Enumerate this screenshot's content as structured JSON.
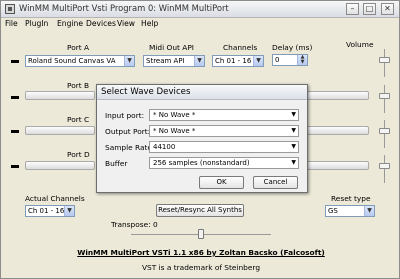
{
  "window": {
    "title": "WinMM MultiPort Vsti Program 0: WinMM MultiPort",
    "minimize": "–",
    "maximize": "□",
    "close": "✕"
  },
  "menu": [
    "File",
    "PlugIn",
    "Engine",
    "Devices",
    "View",
    "Help"
  ],
  "headers": {
    "port": "Port A",
    "midi_out_api": "Midi Out API",
    "channels": "Channels",
    "delay": "Delay (ms)",
    "volume": "Volume"
  },
  "port_a": {
    "device": "Roland Sound Canvas VA",
    "api": "Stream API",
    "channels": "Ch 01 - 16",
    "delay": "0"
  },
  "ports": [
    "Port B",
    "Port C",
    "Port D"
  ],
  "dialog": {
    "title": "Select Wave Devices",
    "input_label": "Input port:",
    "input_value": "* No Wave *",
    "output_label": "Output Port:",
    "output_value": "* No Wave *",
    "rate_label": "Sample Rate:",
    "rate_value": "44100",
    "buffer_label": "Buffer",
    "buffer_value": "256 samples (nonstandard)",
    "ok": "OK",
    "cancel": "Cancel"
  },
  "bottom": {
    "actual_channels_label": "Actual Channels",
    "actual_channels_value": "Ch 01 - 16",
    "reset_button": "Reset/Resync All Synths",
    "reset_type_label": "Reset type",
    "reset_type_value": "GS",
    "transpose": "Transpose: 0",
    "credit": "WinMM MultiPort VSTi 1.1 x86 by Zoltan Bacsko (Falcosoft)",
    "trademark": "VST is a trademark of Steinberg"
  }
}
